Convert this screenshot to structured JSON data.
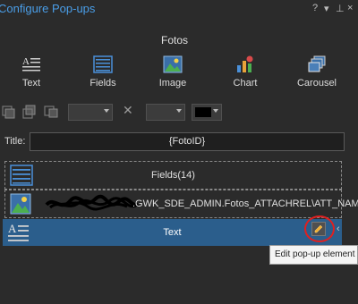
{
  "window": {
    "title": "Configure Pop-ups",
    "controls": {
      "help": "?",
      "menu": "▾",
      "pin": "⊥",
      "close": "×"
    }
  },
  "layer_name": "Fotos",
  "ribbon": {
    "buttons": [
      {
        "label": "Text",
        "icon": "text-icon"
      },
      {
        "label": "Fields",
        "icon": "fields-icon"
      },
      {
        "label": "Image",
        "icon": "image-icon"
      },
      {
        "label": "Chart",
        "icon": "chart-icon"
      },
      {
        "label": "Carousel",
        "icon": "carousel-icon"
      }
    ]
  },
  "title_field": {
    "label": "Title:",
    "value": "{FotoID}"
  },
  "elements": [
    {
      "label": "Fields(14)",
      "icon": "fields-icon"
    },
    {
      "label": ".GWK_SDE_ADMIN.Fotos_ATTACHREL\\ATT_NAME}",
      "icon": "image-icon"
    },
    {
      "label": "Text",
      "icon": "text-icon",
      "selected": true
    }
  ],
  "tooltip": "Edit pop-up element",
  "colors": {
    "accent": "#4a9ee8",
    "selection": "#2b5e8c",
    "annotation": "#e02020",
    "background": "#2b2b2b"
  }
}
